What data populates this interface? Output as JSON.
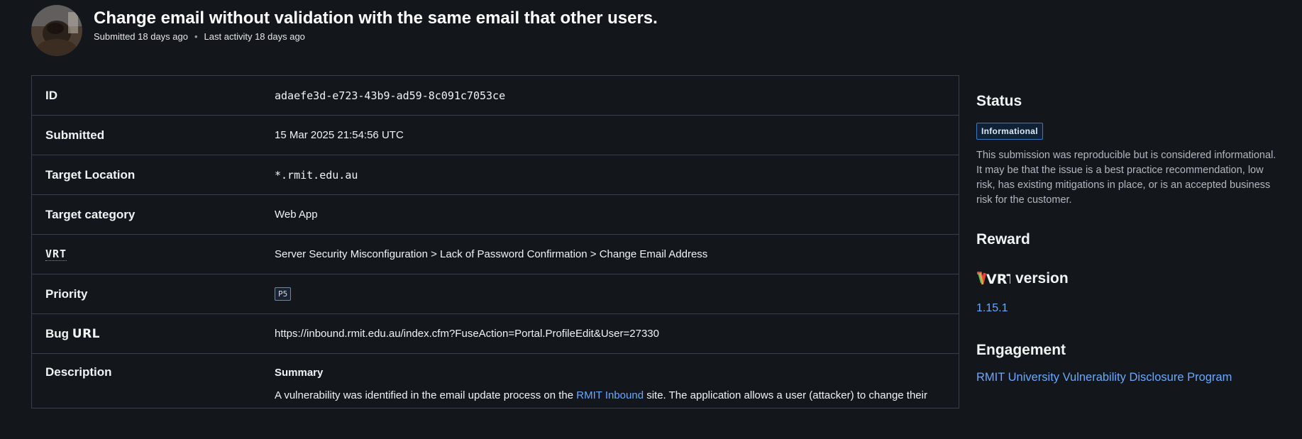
{
  "header": {
    "title": "Change email without validation with the same email that other users.",
    "submitted": "Submitted 18 days ago",
    "separator": "•",
    "last_activity": "Last activity 18 days ago"
  },
  "details": {
    "id": {
      "label": "ID",
      "value": "adaefe3d-e723-43b9-ad59-8c091c7053ce"
    },
    "submitted": {
      "label": "Submitted",
      "value": "15 Mar 2025 21:54:56 UTC"
    },
    "target_location": {
      "label": "Target Location",
      "value": "*.rmit.edu.au"
    },
    "target_category": {
      "label": "Target category",
      "value": "Web App"
    },
    "vrt": {
      "label": "VRT",
      "value": "Server Security Misconfiguration > Lack of Password Confirmation > Change Email Address"
    },
    "priority": {
      "label": "Priority",
      "value": "P5"
    },
    "bug_url": {
      "label_prefix": "Bug ",
      "label_suffix": "URL",
      "value": "https://inbound.rmit.edu.au/index.cfm?FuseAction=Portal.ProfileEdit&User=27330"
    },
    "description": {
      "label": "Description",
      "summary_heading": "Summary",
      "text_before_link": "A vulnerability was identified in the email update process on the ",
      "link_text": "RMIT Inbound",
      "text_after_link": " site. The application allows a user (attacker) to change their"
    }
  },
  "sidebar": {
    "status_heading": "Status",
    "status_badge": "Informational",
    "status_text": "This submission was reproducible but is considered informational. It may be that the issue is a best practice recommendation, low risk, has existing mitigations in place, or is an accepted business risk for the customer.",
    "reward_heading": "Reward",
    "vrt_logo_text": "VRT",
    "vrt_version_heading": "version",
    "vrt_version": "1.15.1",
    "engagement_heading": "Engagement",
    "engagement_link": "RMIT University Vulnerability Disclosure Program"
  },
  "colors": {
    "background": "#13161b",
    "border": "#3a3f47",
    "link": "#6aa8ff",
    "badge_border": "#3a78c2"
  },
  "icons": [
    "avatar",
    "vrt-logo-icon"
  ]
}
